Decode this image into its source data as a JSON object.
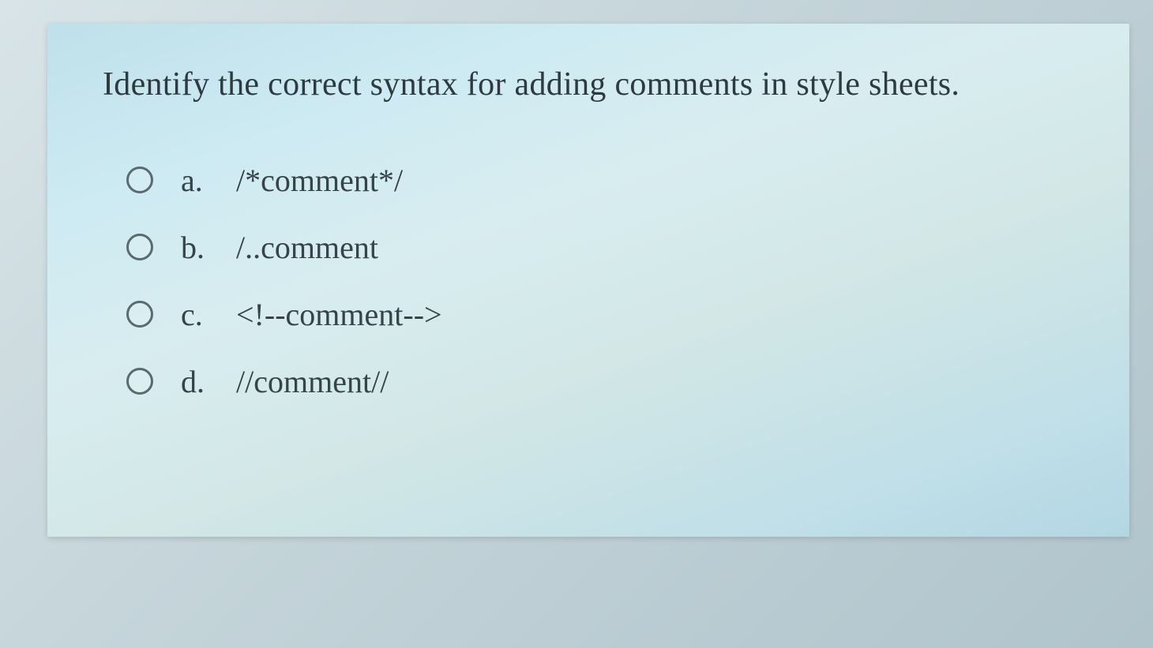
{
  "question": "Identify the correct syntax for adding comments in style sheets.",
  "options": [
    {
      "letter": "a.",
      "text": "/*comment*/"
    },
    {
      "letter": "b.",
      "text": "/..comment"
    },
    {
      "letter": "c.",
      "text": "<!--comment-->"
    },
    {
      "letter": "d.",
      "text": "//comment//"
    }
  ]
}
